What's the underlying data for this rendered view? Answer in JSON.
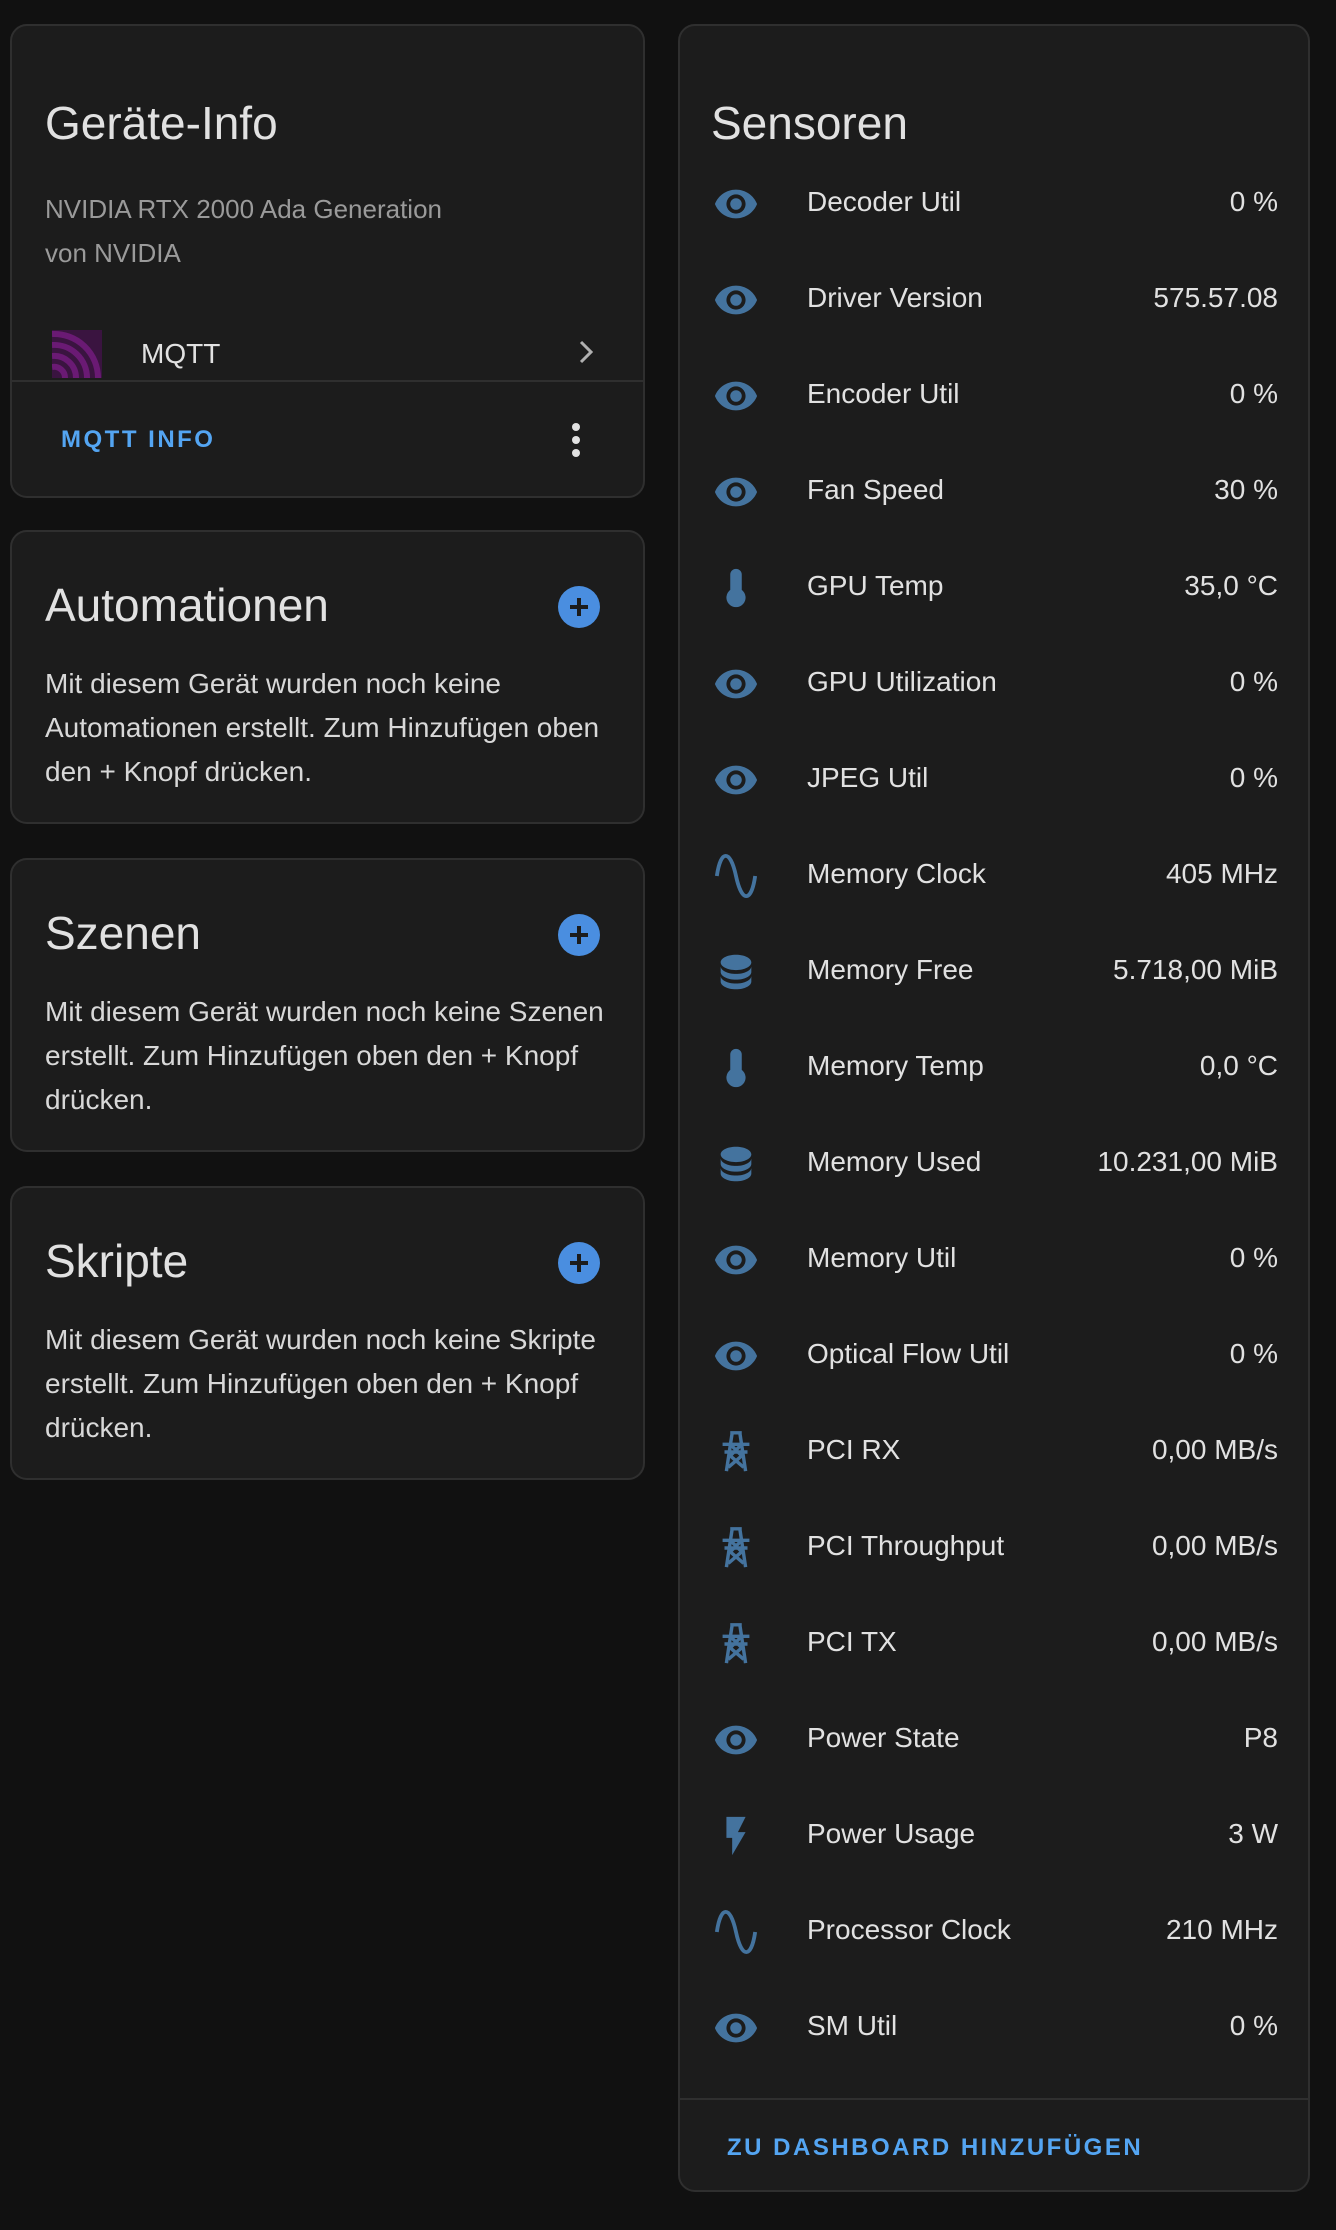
{
  "device_info": {
    "title": "Geräte-Info",
    "model": "NVIDIA RTX 2000 Ada Generation",
    "manufacturer": "von NVIDIA",
    "integration": {
      "label": "MQTT",
      "icon": "mqtt-logo-icon"
    },
    "action_label": "MQTT INFO",
    "menu_icon": "more-vertical-icon"
  },
  "automations": {
    "title": "Automationen",
    "text": "Mit diesem Gerät wurden noch keine Automationen erstellt. Zum Hinzufügen oben den + Knopf drücken."
  },
  "scenes": {
    "title": "Szenen",
    "text": "Mit diesem Gerät wurden noch keine Szenen erstellt. Zum Hinzufügen oben den + Knopf drücken."
  },
  "scripts": {
    "title": "Skripte",
    "text": "Mit diesem Gerät wurden noch keine Skripte erstellt. Zum Hinzufügen oben den + Knopf drücken."
  },
  "sensors": {
    "title": "Sensoren",
    "items": [
      {
        "name": "Decoder Util",
        "value": "0 %",
        "icon": "eye-icon"
      },
      {
        "name": "Driver Version",
        "value": "575.57.08",
        "icon": "eye-icon"
      },
      {
        "name": "Encoder Util",
        "value": "0 %",
        "icon": "eye-icon"
      },
      {
        "name": "Fan Speed",
        "value": "30 %",
        "icon": "eye-icon"
      },
      {
        "name": "GPU Temp",
        "value": "35,0 °C",
        "icon": "thermometer-icon"
      },
      {
        "name": "GPU Utilization",
        "value": "0 %",
        "icon": "eye-icon"
      },
      {
        "name": "JPEG Util",
        "value": "0 %",
        "icon": "eye-icon"
      },
      {
        "name": "Memory Clock",
        "value": "405 MHz",
        "icon": "sine-wave-icon"
      },
      {
        "name": "Memory Free",
        "value": "5.718,00 MiB",
        "icon": "database-icon"
      },
      {
        "name": "Memory Temp",
        "value": "0,0 °C",
        "icon": "thermometer-icon"
      },
      {
        "name": "Memory Used",
        "value": "10.231,00 MiB",
        "icon": "database-icon"
      },
      {
        "name": "Memory Util",
        "value": "0 %",
        "icon": "eye-icon"
      },
      {
        "name": "Optical Flow Util",
        "value": "0 %",
        "icon": "eye-icon"
      },
      {
        "name": "PCI RX",
        "value": "0,00 MB/s",
        "icon": "transmission-tower-icon"
      },
      {
        "name": "PCI Throughput",
        "value": "0,00 MB/s",
        "icon": "transmission-tower-icon"
      },
      {
        "name": "PCI TX",
        "value": "0,00 MB/s",
        "icon": "transmission-tower-icon"
      },
      {
        "name": "Power State",
        "value": "P8",
        "icon": "eye-icon"
      },
      {
        "name": "Power Usage",
        "value": "3 W",
        "icon": "flash-icon"
      },
      {
        "name": "Processor Clock",
        "value": "210 MHz",
        "icon": "sine-wave-icon"
      },
      {
        "name": "SM Util",
        "value": "0 %",
        "icon": "eye-icon"
      }
    ],
    "action_label": "ZU DASHBOARD HINZUFÜGEN"
  },
  "colors": {
    "background": "#111111",
    "card": "#1c1c1c",
    "accent": "#54a5f2",
    "icon": "#44739e",
    "mqtt": "#660066"
  }
}
